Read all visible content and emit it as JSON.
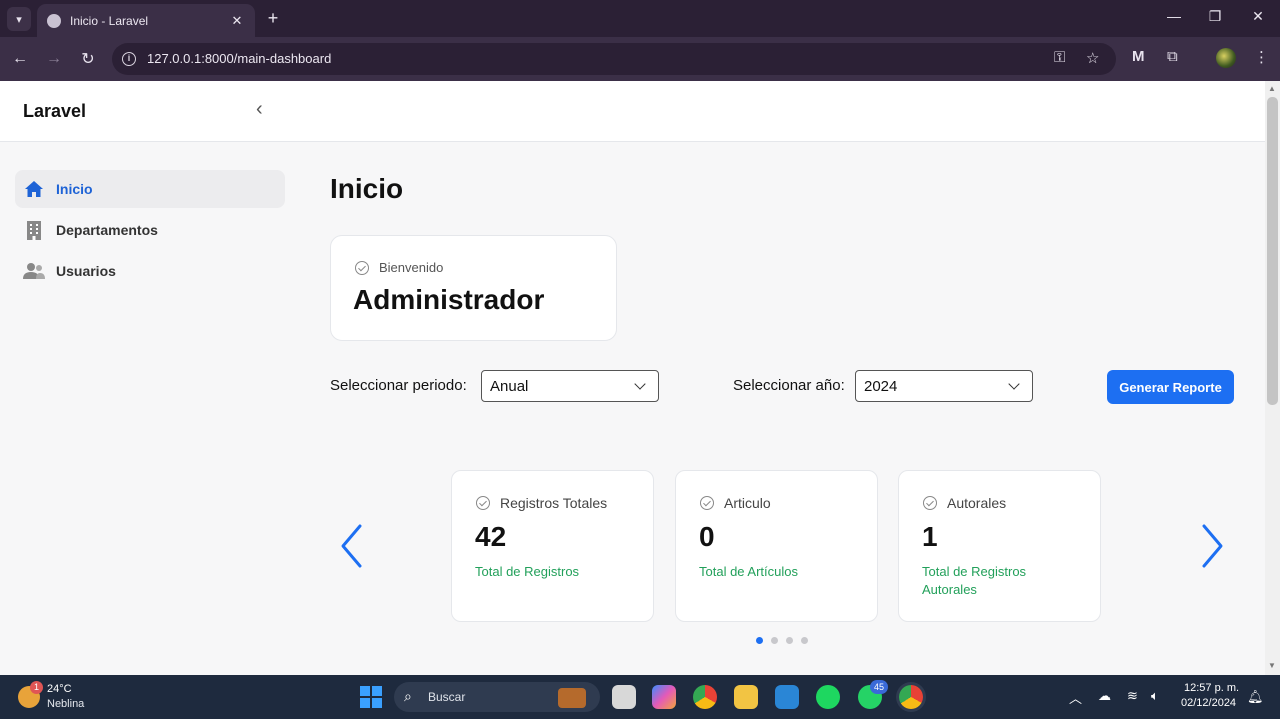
{
  "browser": {
    "tab_title": "Inicio - Laravel",
    "tab_close": "✕",
    "new_tab": "+",
    "url": "127.0.0.1:8000/main-dashboard",
    "window_controls": {
      "minimize": "—",
      "restore": "❐",
      "close": "✕"
    }
  },
  "app": {
    "brand": "Laravel",
    "collapse_icon": "‹",
    "sidebar": [
      {
        "label": "Inicio",
        "icon": "home-icon",
        "active": true
      },
      {
        "label": "Departamentos",
        "icon": "building-icon",
        "active": false
      },
      {
        "label": "Usuarios",
        "icon": "users-icon",
        "active": false
      }
    ],
    "accent_color": "#1d6ff2",
    "success_color": "#22a05a"
  },
  "main": {
    "title": "Inicio",
    "welcome": {
      "label": "Bienvenido",
      "name": "Administrador"
    },
    "filters": {
      "period_label": "Seleccionar periodo:",
      "period_value": "Anual",
      "year_label": "Seleccionar año:",
      "year_value": "2024"
    },
    "report_button": "Generar Reporte",
    "cards": [
      {
        "label": "Registros Totales",
        "value": "42",
        "sub": "Total de Registros"
      },
      {
        "label": "Articulo",
        "value": "0",
        "sub": "Total de Artículos"
      },
      {
        "label": "Autorales",
        "value": "1",
        "sub": "Total de Registros Autorales"
      }
    ],
    "carousel": {
      "pages": 4,
      "active": 0
    }
  },
  "taskbar": {
    "weather_badge": "1",
    "temperature": "24°C",
    "weather": "Neblina",
    "search_placeholder": "Buscar",
    "whatsapp_badge": "45",
    "time": "12:57 p. m.",
    "date": "02/12/2024"
  }
}
